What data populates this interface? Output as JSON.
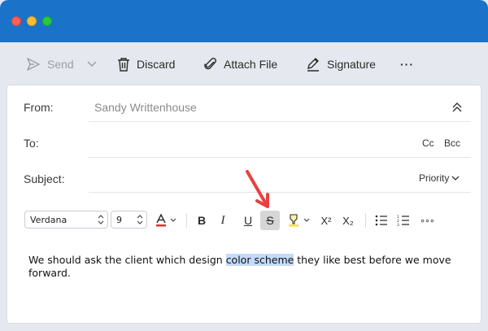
{
  "toolbar": {
    "send_label": "Send",
    "discard_label": "Discard",
    "attach_label": "Attach File",
    "signature_label": "Signature",
    "more_label": "···"
  },
  "header": {
    "from_label": "From:",
    "from_value": "Sandy Writtenhouse",
    "to_label": "To:",
    "cc_label": "Cc",
    "bcc_label": "Bcc",
    "subject_label": "Subject:",
    "priority_label": "Priority"
  },
  "format": {
    "font_value": "Verdana",
    "size_value": "9",
    "bold": "B",
    "italic": "I",
    "underline": "U",
    "strike": "S",
    "super": "X²",
    "sub": "X₂",
    "overflow": "∘∘∘"
  },
  "body": {
    "text_before": "We should ask the client which design ",
    "text_highlight": "color scheme",
    "text_after": " they like best before we move forward."
  },
  "colors": {
    "titlebar": "#1a73c9",
    "arrow": "#e9403f",
    "highlight": "#c4dafa"
  }
}
